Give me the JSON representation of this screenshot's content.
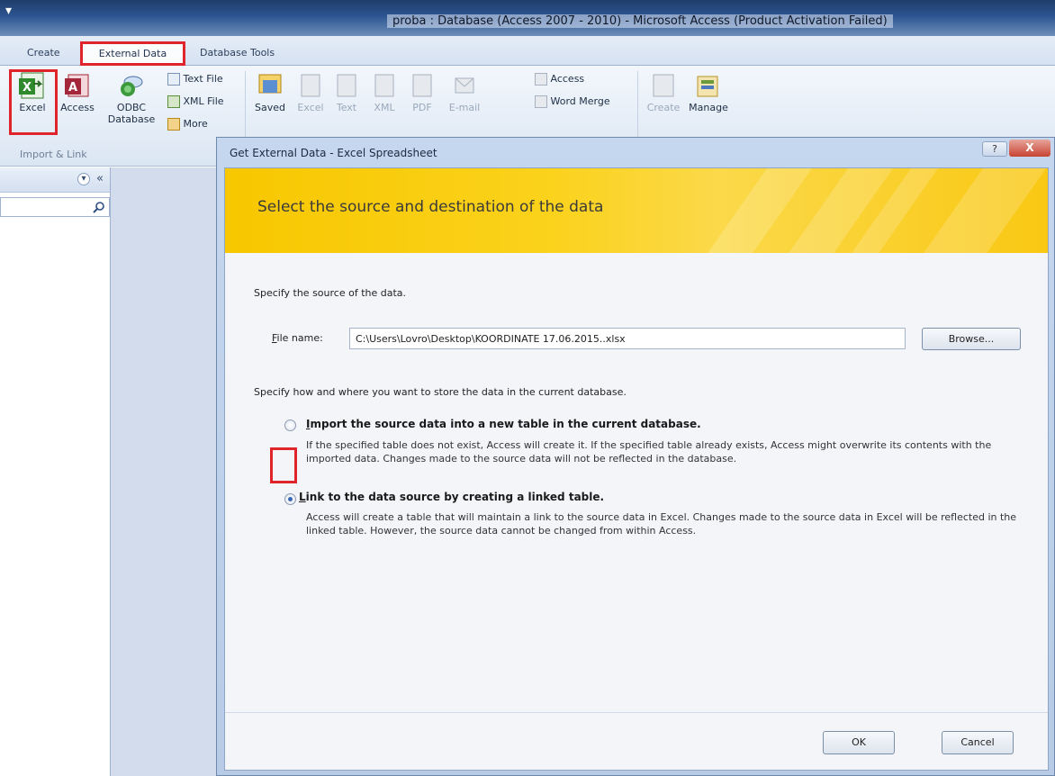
{
  "window": {
    "quick_access": "▾",
    "title": "proba : Database (Access 2007 - 2010) - Microsoft Access (Product Activation Failed)"
  },
  "tabs": {
    "create": "Create",
    "external_data": "External Data",
    "database_tools": "Database Tools"
  },
  "ribbon": {
    "import_link": {
      "excel": "Excel",
      "access": "Access",
      "odbc_line1": "ODBC",
      "odbc_line2": "Database",
      "text_file": "Text File",
      "xml_file": "XML File",
      "more": "More",
      "group_label": "Import & Link"
    },
    "export": {
      "saved": "Saved",
      "excel": "Excel",
      "text": "Text",
      "xml": "XML",
      "pdf": "PDF",
      "email": "E-mail",
      "access": "Access",
      "word_merge": "Word Merge"
    },
    "collect": {
      "create": "Create",
      "manage": "Manage"
    }
  },
  "nav": {
    "chevron": "«",
    "dropdown": "▾"
  },
  "dialog": {
    "title": "Get External Data - Excel Spreadsheet",
    "help_button": "?",
    "close_button": "X",
    "banner_title": "Select the source and destination of the data",
    "source_prompt": "Specify the source of the data.",
    "file_name_label_u": "F",
    "file_name_label_rest": "ile name:",
    "file_name_value": "C:\\Users\\Lovro\\Desktop\\KOORDINATE 17.06.2015..xlsx",
    "browse_button": "Browse...",
    "store_prompt": "Specify how and where you want to store the data in the current database.",
    "option_import": {
      "title_u": "I",
      "title_rest": "mport the source data into a new table in the current database.",
      "description": "If the specified table does not exist, Access will create it. If the specified table already exists, Access might overwrite its contents with the imported data. Changes made to the source data will not be reflected in the database.",
      "selected": false
    },
    "option_link": {
      "title_u": "L",
      "title_rest": "ink to the data source by creating a linked table.",
      "description": "Access will create a table that will maintain a link to the source data in Excel. Changes made to the source data in Excel will be reflected in the linked table. However, the source data cannot be changed from within Access.",
      "selected": true
    },
    "ok_button": "OK",
    "cancel_button": "Cancel"
  },
  "colors": {
    "highlight": "#e0242c",
    "banner": "#f9c813",
    "title_bar": "#2d5591"
  }
}
